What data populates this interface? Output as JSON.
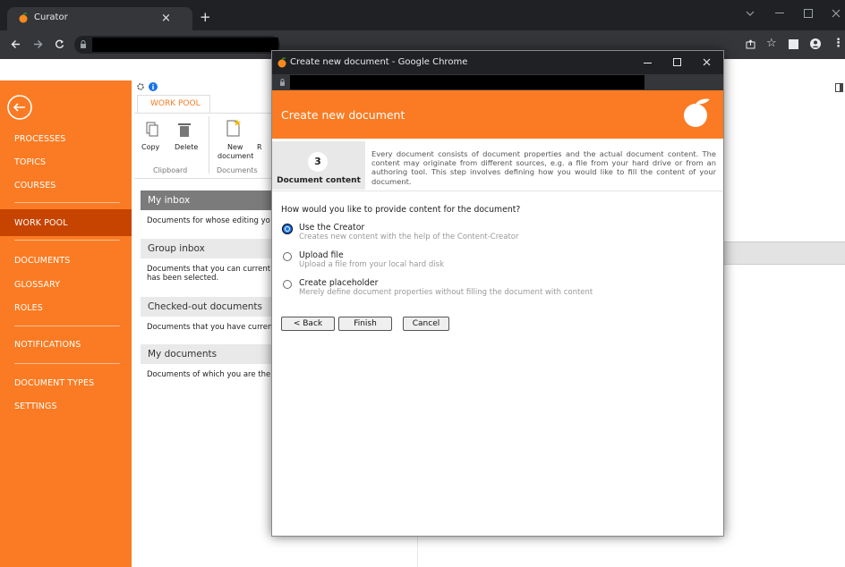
{
  "browser": {
    "tab_title": "Curator",
    "close_glyph": "×",
    "new_tab_glyph": "+"
  },
  "sidebar": {
    "items": [
      {
        "label": "PROCESSES"
      },
      {
        "label": "TOPICS"
      },
      {
        "label": "COURSES"
      },
      {
        "label": "WORK POOL"
      },
      {
        "label": "DOCUMENTS"
      },
      {
        "label": "GLOSSARY"
      },
      {
        "label": "ROLES"
      },
      {
        "label": "NOTIFICATIONS"
      },
      {
        "label": "DOCUMENT TYPES"
      },
      {
        "label": "SETTINGS"
      }
    ]
  },
  "ribbon": {
    "tab": "WORK POOL",
    "copy": "Copy",
    "delete": "Delete",
    "new_doc_line1": "New",
    "new_doc_line2": "document",
    "clipboard_group": "Clipboard",
    "documents_group": "Documents",
    "cut_label": "R"
  },
  "sections": [
    {
      "title": "My inbox",
      "desc": "Documents for whose editing yo"
    },
    {
      "title": "Group inbox",
      "desc": "Documents that you can current",
      "desc2": "has been selected."
    },
    {
      "title": "Checked-out documents",
      "desc": "Documents that you have curren"
    },
    {
      "title": "My documents",
      "desc": "Documents of which you are the"
    }
  ],
  "dialog": {
    "window_title": "Create new document - Google Chrome",
    "header": "Create new document",
    "step_number": "3",
    "step_label": "Document content",
    "step_description": "Every document consists of document properties and the actual document content. The content may originate from different sources, e.g. a file from your hard drive or from an authoring tool. This step involves defining how you would like to fill the content of your document.",
    "question": "How would you like to provide content for the document?",
    "options": [
      {
        "label": "Use the Creator",
        "sub": "Creates new content with the help of the Content-Creator",
        "selected": true
      },
      {
        "label": "Upload file",
        "sub": "Upload a file from your local hard disk",
        "selected": false
      },
      {
        "label": "Create placeholder",
        "sub": "Merely define document properties without filling the document with content",
        "selected": false
      }
    ],
    "back_label": "< Back",
    "finish_label": "Finish",
    "cancel_label": "Cancel"
  },
  "colors": {
    "brand": "#fa7b23",
    "brand_dark": "#c64400"
  }
}
